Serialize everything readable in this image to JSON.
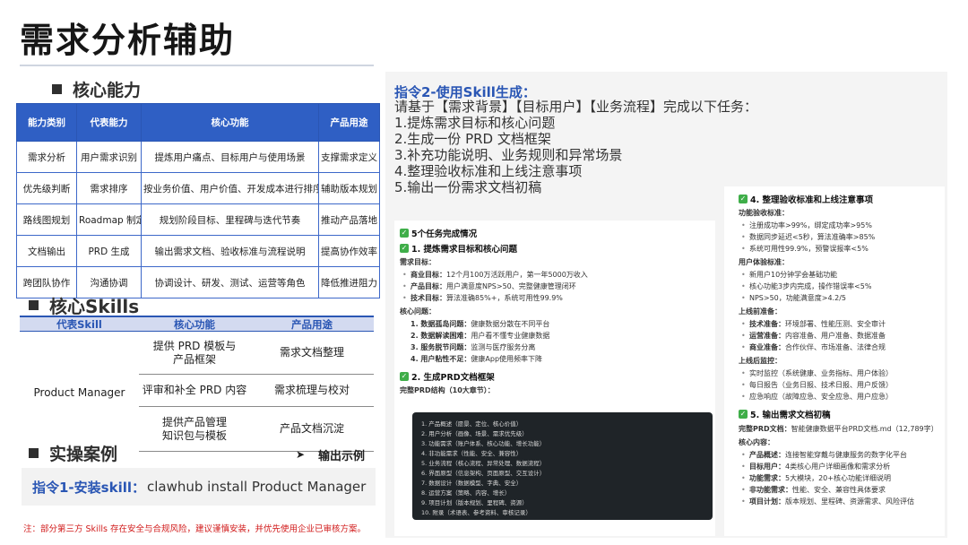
{
  "title": "需求分析辅助",
  "sections": {
    "ability": "核心能力",
    "skills": "核心Skills",
    "cases": "实操案例"
  },
  "ability_table": {
    "headers": [
      "能力类别",
      "代表能力",
      "核心功能",
      "产品用途"
    ],
    "rows": [
      [
        "需求分析",
        "用户需求识别",
        "提炼用户痛点、目标用户与使用场景",
        "支撑需求定义"
      ],
      [
        "优先级判断",
        "需求排序",
        "按业务价值、用户价值、开发成本进行排序",
        "辅助版本规划"
      ],
      [
        "路线图规划",
        "Roadmap 制定",
        "规划阶段目标、里程碑与迭代节奏",
        "推动产品落地"
      ],
      [
        "文档输出",
        "PRD 生成",
        "输出需求文档、验收标准与流程说明",
        "提高协作效率"
      ],
      [
        "跨团队协作",
        "沟通协调",
        "协调设计、研发、测试、运营等角色",
        "降低推进阻力"
      ]
    ]
  },
  "skills_table": {
    "headers": [
      "代表Skill",
      "核心功能",
      "产品用途"
    ],
    "skill": "Product Manager",
    "rows": [
      {
        "func": [
          "提供 PRD 模板与",
          "产品框架"
        ],
        "use": "需求文档整理"
      },
      {
        "func": [
          "评审和补全 PRD 内容"
        ],
        "use": "需求梳理与校对"
      },
      {
        "func": [
          "提供产品管理",
          "知识包与模板"
        ],
        "use": "产品文档沉淀"
      }
    ]
  },
  "example": {
    "arrow": "➤",
    "label": "输出示例"
  },
  "cmd1": {
    "key": "指令1-安装skill：",
    "value": "clawhub install Product Manager"
  },
  "note": "注：部分第三方 Skills 存在安全与合规风险，建议谨慎安装，并优先使用企业已审核方案。",
  "cmd2": {
    "title": "指令2-使用Skill生成：",
    "lines": [
      "请基于【需求背景】【目标用户】【业务流程】完成以下任务：",
      "1.提炼需求目标和核心问题",
      "2.生成一份 PRD 文档框架",
      "3.补充功能说明、业务规则和异常场景",
      "4.整理验收标准和上线注意事项",
      "5.输出一份需求文档初稿"
    ]
  },
  "shot_left": {
    "head": "5个任务完成情况",
    "s1": "1. 提炼需求目标和核心问题",
    "s1_sub": "需求目标：",
    "s1_items": [
      {
        "k": "商业目标：",
        "v": "12个月100万活跃用户，第一年5000万收入"
      },
      {
        "k": "产品目标：",
        "v": "用户满意度NPS>50、完整健康管理闭环"
      },
      {
        "k": "技术目标：",
        "v": "算法准确85%+，系统可用性99.9%"
      }
    ],
    "s1_sub2": "核心问题：",
    "s1_problems": [
      {
        "k": "1. 数据孤岛问题：",
        "v": "健康数据分散在不同平台"
      },
      {
        "k": "2. 数据解读困难：",
        "v": "用户看不懂专业健康数据"
      },
      {
        "k": "3. 服务脱节问题：",
        "v": "监测与医疗服务分离"
      },
      {
        "k": "4. 用户粘性不足：",
        "v": "健康App使用频率下降"
      }
    ],
    "s2": "2. 生成PRD文档框架",
    "s2_sub": "完整PRD结构（10大章节）：",
    "code": [
      "1. 产品概述（愿景、定位、核心价值）",
      "2. 用户分析（画像、场景、需求优先级）",
      "3. 功能需求（账户体系、核心功能、增长功能）",
      "4. 非功能需求（性能、安全、兼容性）",
      "5. 业务流程（核心流程、异常处理、数据流程）",
      "6. 界面原型（信息架构、页面原型、交互设计）",
      "7. 数据设计（数据模型、字典、安全）",
      "8. 运营方案（策略、内容、增长）",
      "9. 项目计划（版本规划、里程碑、资源）",
      "10. 附录（术语表、参考资料、审核记录）"
    ]
  },
  "shot_right": {
    "s4": "4. 整理验收标准和上线注意事项",
    "func_title": "功能验收标准：",
    "func_items": [
      "注册成功率>99%，绑定成功率>95%",
      "数据同步延迟<5秒，算法准确率>85%",
      "系统可用性99.9%，预警误报率<5%"
    ],
    "ux_title": "用户体验标准：",
    "ux_items": [
      "新用户10分钟学会基础功能",
      "核心功能3步内完成，操作错误率<5%",
      "NPS>50，功能满意度>4.2/5"
    ],
    "pre_title": "上线前准备：",
    "pre_items": [
      {
        "k": "技术准备：",
        "v": "环境部署、性能压测、安全审计"
      },
      {
        "k": "运营准备：",
        "v": "内容准备、用户准备、数据准备"
      },
      {
        "k": "商业准备：",
        "v": "合作伙伴、市场准备、法律合规"
      }
    ],
    "post_title": "上线后监控：",
    "post_items": [
      "实时监控（系统健康、业务指标、用户体验）",
      "每日报告（业务日报、技术日报、用户反馈）",
      "应急响应（故障应急、安全应急、用户应急）"
    ],
    "s5": "5. 输出需求文档初稿",
    "prd_line_k": "完整PRD文档：",
    "prd_line_v": "智能健康数据平台PRD文档.md（12,789字）",
    "content_title": "核心内容：",
    "content_items": [
      {
        "k": "产品概述：",
        "v": "连接智能穿戴与健康服务的数字化平台"
      },
      {
        "k": "目标用户：",
        "v": "4类核心用户详细画像和需求分析"
      },
      {
        "k": "功能需求：",
        "v": "5大模块，20+核心功能详细说明"
      },
      {
        "k": "非功能需求：",
        "v": "性能、安全、兼容性具体要求"
      },
      {
        "k": "项目计划：",
        "v": "版本规划、里程碑、资源需求、风险评估"
      }
    ]
  },
  "icons": {
    "check": "check-icon",
    "bullet": "square-bullet-icon",
    "arrow": "arrow-right-icon"
  },
  "colors": {
    "accent": "#2f5fc4",
    "note": "#d11a1a",
    "check": "#3fae49"
  }
}
